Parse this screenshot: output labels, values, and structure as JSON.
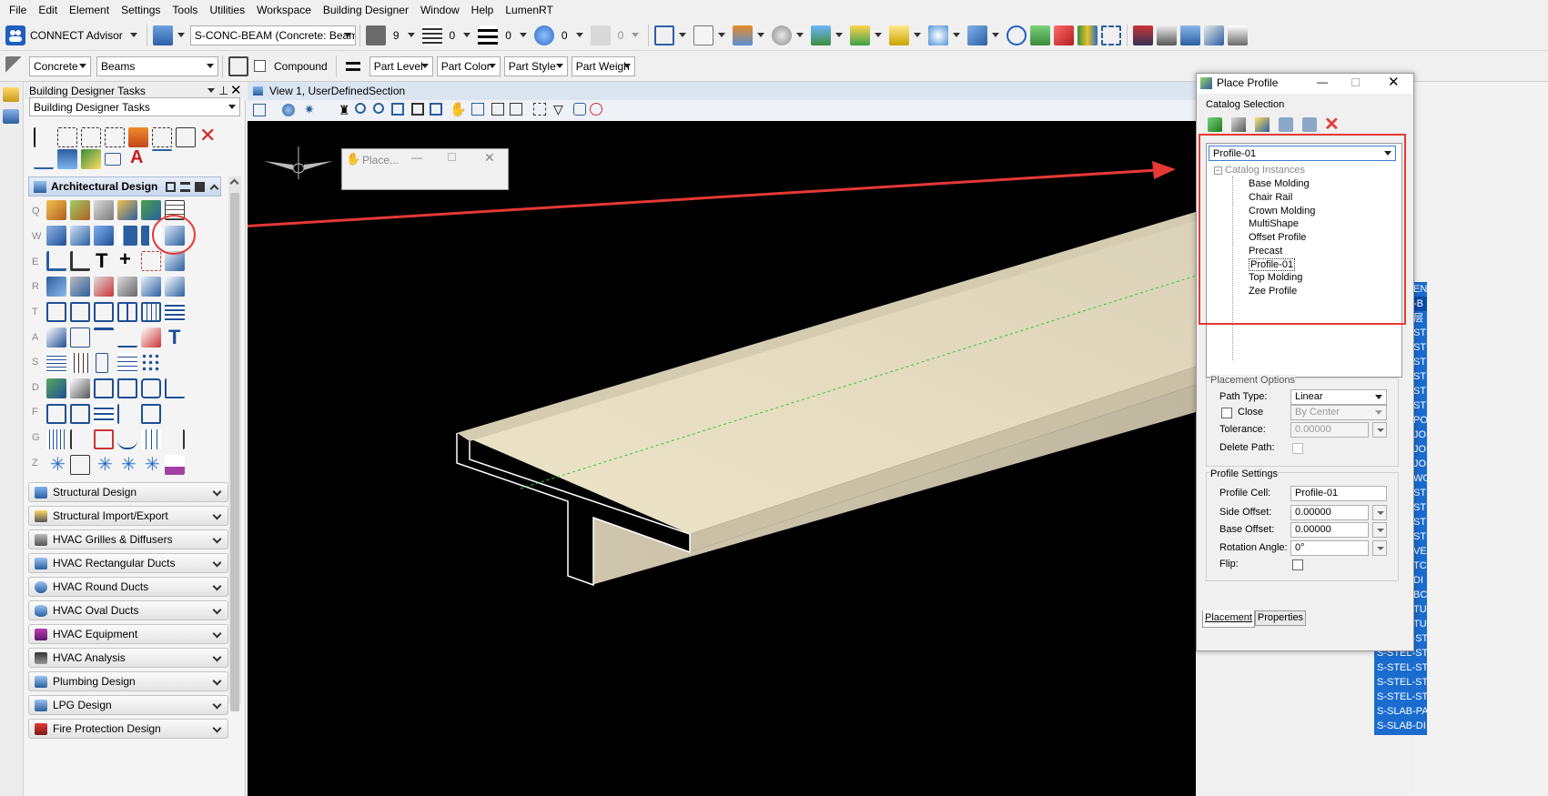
{
  "menu": [
    "File",
    "Edit",
    "Element",
    "Settings",
    "Tools",
    "Utilities",
    "Workspace",
    "Building Designer",
    "Window",
    "Help",
    "LumenRT"
  ],
  "toolbar1": {
    "connect_advisor": "CONNECT Advisor",
    "level_combo": "S-CONC-BEAM (Concrete: Beams)",
    "color_value": "9",
    "style_value": "0",
    "weight_value": "0",
    "transparency_value": "0",
    "priority_value": "0"
  },
  "toolbar2": {
    "family": "Concrete",
    "part": "Beams",
    "compound_label": "Compound",
    "buttons": [
      "Part Level",
      "Part Color",
      "Part Style",
      "Part Weigh"
    ]
  },
  "task_panel": {
    "title": "Building Designer Tasks",
    "selector": "Building Designer Tasks",
    "active_section": "Architectural Design",
    "row_letters": [
      "Q",
      "W",
      "E",
      "R",
      "T",
      "A",
      "S",
      "D",
      "F",
      "G",
      "Z"
    ],
    "sections": [
      "Structural Design",
      "Structural Import/Export",
      "HVAC Grilles & Diffusers",
      "HVAC Rectangular Ducts",
      "HVAC Round Ducts",
      "HVAC Oval Ducts",
      "HVAC Equipment",
      "HVAC Analysis",
      "Plumbing Design",
      "LPG Design",
      "Fire Protection Design"
    ]
  },
  "view": {
    "title": "View 1, UserDefinedSection",
    "mini_dialog_title": "Place..."
  },
  "dialog": {
    "title": "Place Profile",
    "catalog_selection_label": "Catalog Selection",
    "selected_profile": "Profile-01",
    "tree_root": "Catalog Instances",
    "tree_items": [
      "Base Molding",
      "Chair Rail",
      "Crown Molding",
      "MultiShape",
      "Offset Profile",
      "Precast",
      "Profile-01",
      "Top Molding",
      "Zee Profile"
    ],
    "placement_options_label": "Placement Options",
    "path_type_label": "Path Type:",
    "path_type_value": "Linear",
    "close_label": "Close",
    "close_value": "By Center",
    "tolerance_label": "Tolerance:",
    "tolerance_value": "0.00000",
    "delete_path_label": "Delete Path:",
    "profile_settings_label": "Profile Settings",
    "profile_cell_label": "Profile Cell:",
    "profile_cell_value": "Profile-01",
    "side_offset_label": "Side Offset:",
    "side_offset_value": "0.00000",
    "base_offset_label": "Base Offset:",
    "base_offset_value": "0.00000",
    "rotation_label": "Rotation Angle:",
    "rotation_value": "0°",
    "flip_label": "Flip:",
    "tabs": [
      "Placement",
      "Properties"
    ]
  },
  "layers": [
    "S-STEL-STU",
    "S-STEL-STU",
    "S-STEL-STU",
    "S-STEL-STU",
    "S-STEL-STU",
    "S-SLAB-PAD",
    "S-SLAB-DI"
  ],
  "layer_codes_partial": [
    "ENI",
    "-B",
    "层",
    "ST",
    "ST",
    "ST",
    "ST",
    "ST",
    "ST",
    "PO",
    "JO",
    "JO",
    "JO",
    "WO",
    "ST",
    "ST",
    "ST",
    "ST",
    "VE",
    "TC",
    "DI",
    "BC",
    "TU",
    "TU"
  ],
  "colors": {
    "accent_red": "#e53935",
    "layer_blue": "#1a6ccf",
    "view_title_bg": "#dbe5f1"
  }
}
